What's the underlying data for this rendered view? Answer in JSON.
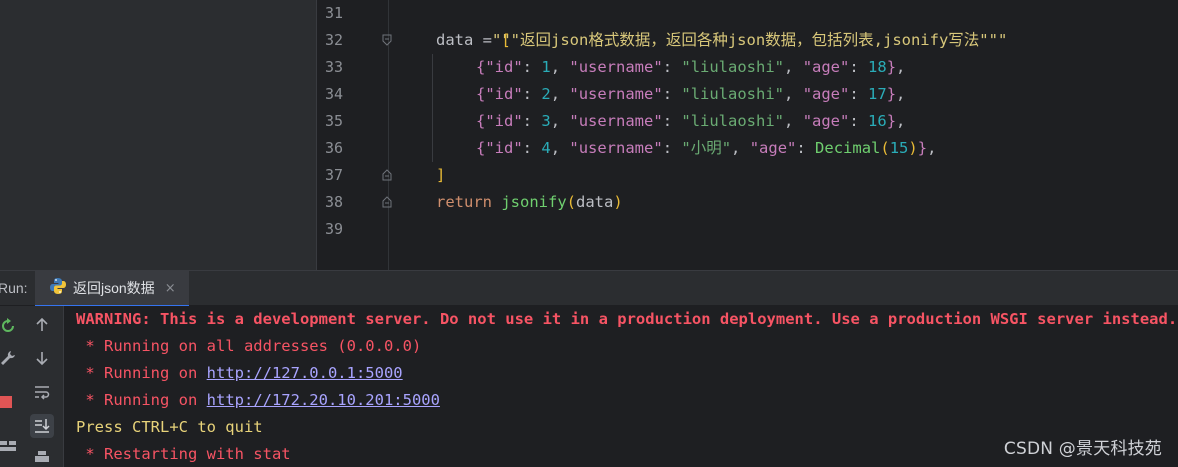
{
  "editor": {
    "line_numbers": [
      "31",
      "32",
      "33",
      "34",
      "35",
      "36",
      "37",
      "38",
      "39"
    ],
    "lines": {
      "l31": {
        "docstring": "\"\"\"返回json格式数据，返回各种json数据，包括列表,jsonify写法\"\"\""
      },
      "l32": {
        "var": "data",
        "op": " = ",
        "bracket": "["
      },
      "l33": {
        "open": "{",
        "k1": "\"id\"",
        "c1": ": ",
        "v1": "1",
        "s1": ", ",
        "k2": "\"username\"",
        "c2": ": ",
        "v2": "\"liulaoshi\"",
        "s2": ", ",
        "k3": "\"age\"",
        "c3": ": ",
        "v3": "18",
        "close": "}",
        "tail": ","
      },
      "l34": {
        "open": "{",
        "k1": "\"id\"",
        "c1": ": ",
        "v1": "2",
        "s1": ", ",
        "k2": "\"username\"",
        "c2": ": ",
        "v2": "\"liulaoshi\"",
        "s2": ", ",
        "k3": "\"age\"",
        "c3": ": ",
        "v3": "17",
        "close": "}",
        "tail": ","
      },
      "l35": {
        "open": "{",
        "k1": "\"id\"",
        "c1": ": ",
        "v1": "3",
        "s1": ", ",
        "k2": "\"username\"",
        "c2": ": ",
        "v2": "\"liulaoshi\"",
        "s2": ", ",
        "k3": "\"age\"",
        "c3": ": ",
        "v3": "16",
        "close": "}",
        "tail": ","
      },
      "l36": {
        "open": "{",
        "k1": "\"id\"",
        "c1": ": ",
        "v1": "4",
        "s1": ", ",
        "k2": "\"username\"",
        "c2": ": ",
        "v2": "\"小明\"",
        "s2": ", ",
        "k3": "\"age\"",
        "c3": ": ",
        "fn": "Decimal",
        "po": "(",
        "v3": "15",
        "pc": ")",
        "close": "}",
        "tail": ","
      },
      "l37": {
        "bracket": "]"
      },
      "l38": {
        "kw": "return",
        "sp": " ",
        "fn": "jsonify",
        "po": "(",
        "arg": "data",
        "pc": ")"
      }
    }
  },
  "run_panel": {
    "label": "Run:",
    "tab": {
      "label": "返回json数据",
      "close": "×",
      "icon": "python-icon"
    },
    "output": {
      "warning": "WARNING: This is a development server. Do not use it in a production deployment. Use a production WSGI server instead.",
      "line2": " * Running on all addresses (0.0.0.0)",
      "line3_prefix": " * Running on ",
      "line3_link": "http://127.0.0.1:5000",
      "line4_prefix": " * Running on ",
      "line4_link": "http://172.20.10.201:5000",
      "line5": "Press CTRL+C to quit",
      "line6": " * Restarting with stat"
    }
  },
  "watermark": "CSDN @景天科技苑",
  "colors": {
    "background": "#1e1f22",
    "panel": "#2b2d30",
    "warning": "#f75464",
    "link": "#a9a4ff",
    "accent": "#3574f0"
  }
}
